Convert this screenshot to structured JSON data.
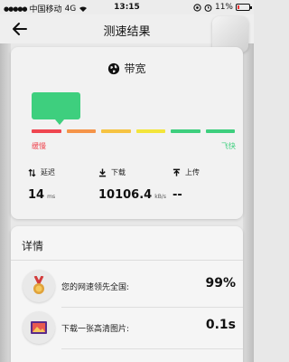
{
  "status_bar": {
    "carrier": "中国移动",
    "network": "4G",
    "time": "13:15",
    "battery_percent": "11%"
  },
  "nav": {
    "title": "测速结果"
  },
  "bandwidth": {
    "title": "带宽",
    "scale_slow_label": "缓慢",
    "scale_fast_label": "飞快",
    "scale_colors": [
      "#ef4650",
      "#f59449",
      "#f6c342",
      "#f3e53b",
      "#3ecf7e",
      "#3ecf7e"
    ],
    "slow_color": "#ef4650",
    "fast_color": "#3ecf7e",
    "meter_color": "#3ecf7e"
  },
  "metrics": {
    "latency": {
      "label": "延迟",
      "value": "14",
      "unit": "ms"
    },
    "download": {
      "label": "下载",
      "value": "10106.4",
      "unit": "kB/s"
    },
    "upload": {
      "label": "上传",
      "value": "--"
    }
  },
  "details": {
    "title": "详情",
    "rows": [
      {
        "text": "您的网速领先全国:",
        "value": "99%",
        "icon": "medal-icon"
      },
      {
        "text": "下载一张高清图片:",
        "value": "0.1s",
        "icon": "photo-icon"
      }
    ]
  }
}
